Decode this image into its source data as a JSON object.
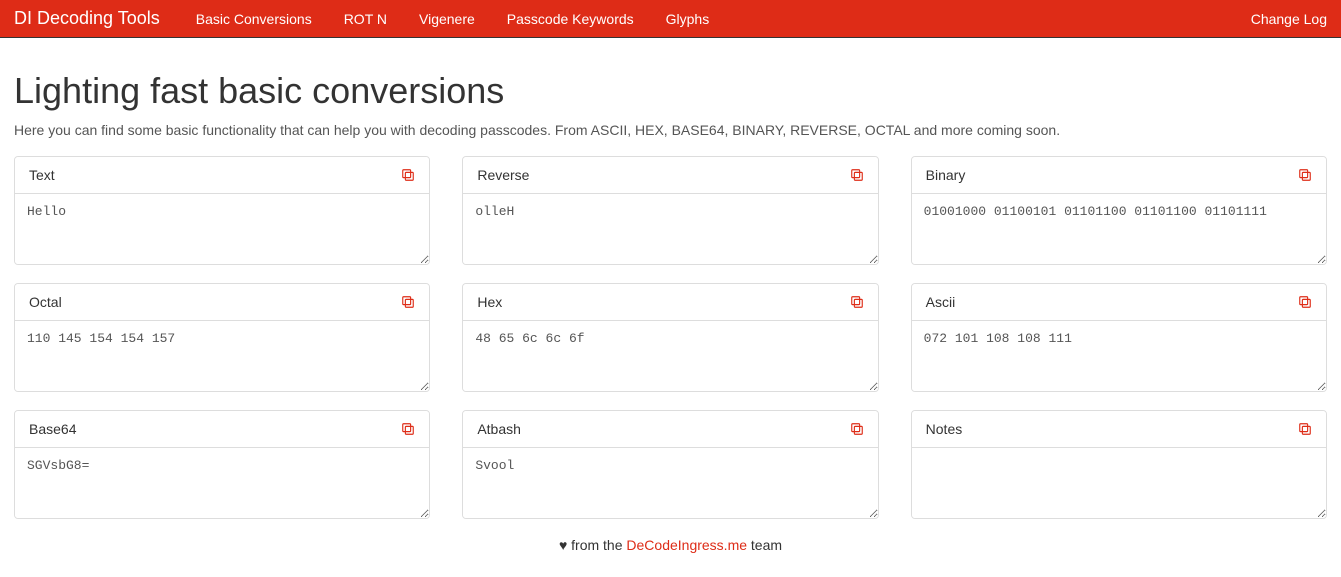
{
  "nav": {
    "brand": "DI Decoding Tools",
    "links": [
      "Basic Conversions",
      "ROT N",
      "Vigenere",
      "Passcode Keywords",
      "Glyphs"
    ],
    "right": "Change Log"
  },
  "page": {
    "title": "Lighting fast basic conversions",
    "description": "Here you can find some basic functionality that can help you with decoding passcodes. From ASCII, HEX, BASE64, BINARY, REVERSE, OCTAL and more coming soon."
  },
  "panels": [
    {
      "label": "Text",
      "value": "Hello"
    },
    {
      "label": "Reverse",
      "value": "olleH"
    },
    {
      "label": "Binary",
      "value": "01001000 01100101 01101100 01101100 01101111"
    },
    {
      "label": "Octal",
      "value": "110 145 154 154 157"
    },
    {
      "label": "Hex",
      "value": "48 65 6c 6c 6f"
    },
    {
      "label": "Ascii",
      "value": "072 101 108 108 111"
    },
    {
      "label": "Base64",
      "value": "SGVsbG8="
    },
    {
      "label": "Atbash",
      "value": "Svool"
    },
    {
      "label": "Notes",
      "value": ""
    }
  ],
  "footer": {
    "prefix": "♥ from the ",
    "link": "DeCodeIngress.me",
    "suffix": " team"
  }
}
